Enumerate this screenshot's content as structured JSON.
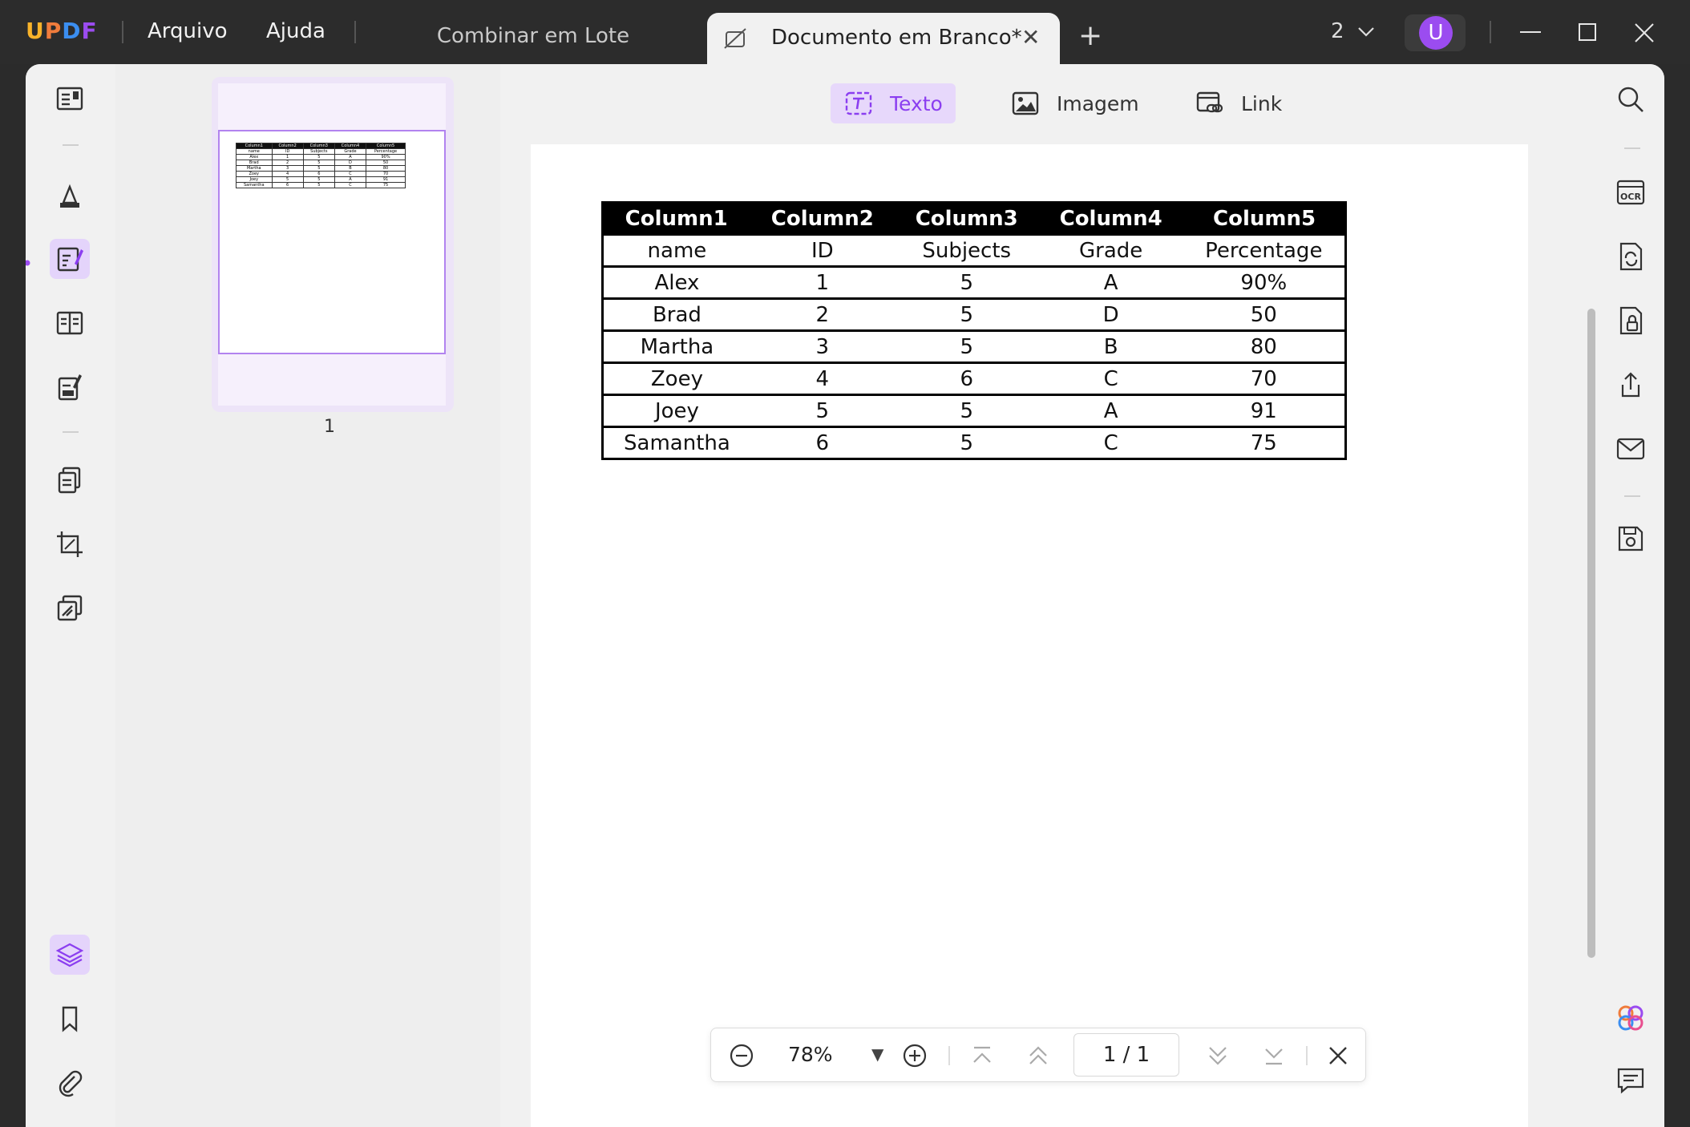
{
  "app": {
    "logo": "UPDF",
    "logo_colors": [
      "#f9b32a",
      "#f07c3c",
      "#3b8ef0",
      "#9b4cf0"
    ],
    "accent": "#8b3ef0"
  },
  "menu": {
    "file": "Arquivo",
    "help": "Ajuda"
  },
  "tabs": {
    "batch": "Combinar em Lote",
    "active": "Documento em Branco*",
    "close_glyph": "✕",
    "plus_glyph": "+"
  },
  "titlebar": {
    "window_count": "2",
    "avatar_letter": "U"
  },
  "edit_tools": {
    "text": "Texto",
    "image": "Imagem",
    "link": "Link"
  },
  "thumbnail": {
    "page_number": "1"
  },
  "table": {
    "headers": [
      "Column1",
      "Column2",
      "Column3",
      "Column4",
      "Column5"
    ],
    "rows": [
      [
        "name",
        "ID",
        "Subjects",
        "Grade",
        "Percentage"
      ],
      [
        "Alex",
        "1",
        "5",
        "A",
        "90%"
      ],
      [
        "Brad",
        "2",
        "5",
        "D",
        "50"
      ],
      [
        "Martha",
        "3",
        "5",
        "B",
        "80"
      ],
      [
        "Zoey",
        "4",
        "6",
        "C",
        "70"
      ],
      [
        "Joey",
        "5",
        "5",
        "A",
        "91"
      ],
      [
        "Samantha",
        "6",
        "5",
        "C",
        "75"
      ]
    ]
  },
  "navigation": {
    "zoom": "78%",
    "page_indicator": "1 / 1"
  },
  "icons": {
    "left": [
      "reader-icon",
      "comment-icon",
      "edit-pdf-icon",
      "organize-icon",
      "fill-sign-icon",
      "pages-icon",
      "crop-icon",
      "compare-icon",
      "layers-icon",
      "bookmark-icon",
      "attachment-icon"
    ],
    "right": [
      "search-icon",
      "ocr-icon",
      "convert-icon",
      "protect-icon",
      "share-icon",
      "email-icon",
      "save-icon",
      "ai-assistant-icon",
      "comments-panel-icon"
    ]
  }
}
